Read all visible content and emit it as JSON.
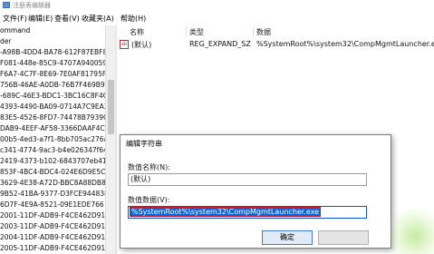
{
  "window": {
    "title": "注册表编辑器"
  },
  "menubar": [
    "文件(F)",
    "编辑(E)",
    "查看(V)",
    "收藏夹(A)",
    "帮助(H)"
  ],
  "tree": [
    {
      "label": "ommand",
      "selected": true
    },
    {
      "label": "der",
      "selected": false
    },
    {
      "label": "-A98B-4DD4-BA78-612F87EBF8",
      "selected": false
    },
    {
      "label": "F081-448e-85C9-4707A9400593",
      "selected": false
    },
    {
      "label": "F6A7-4C7F-8E69-7E0AF81795FB",
      "selected": false
    },
    {
      "label": "756B-46AE-A0DB-76B7F469B92",
      "selected": false
    },
    {
      "label": "-689C-46E3-BDC1-3BC16C8F4C5",
      "selected": false
    },
    {
      "label": "4393-4490-BA09-0714A7C9EA3",
      "selected": false
    },
    {
      "label": "83E5-4526-8FD7-74478B7939CD",
      "selected": false
    },
    {
      "label": "DAB9-4EEF-AF58-3366DAAF4C4",
      "selected": false
    },
    {
      "label": "00b5-4ed3-a7f1-8bb705ac276a",
      "selected": false
    },
    {
      "label": "c341-4774-9ac3-b4e026347f64",
      "selected": false
    },
    {
      "label": "2419-4373-b102-6843707eb41",
      "selected": false
    },
    {
      "label": "853F-4BC4-BDC4-024E6D9E5C5",
      "selected": false
    },
    {
      "label": "3629-4E38-A72D-BBC8A88DB81",
      "selected": false
    },
    {
      "label": "9B52-41BA-9377-D3FCE9448381",
      "selected": false
    },
    {
      "label": "6D7F-4E9A-8521-09E1EDE766",
      "selected": false
    },
    {
      "label": "2001-11DF-ADB9-F4CE462D913",
      "selected": false
    },
    {
      "label": "2003-11DF-ADB9-F4CE462D913",
      "selected": false
    },
    {
      "label": "2004-11DF-ADB9-F4CE462D913",
      "selected": false
    },
    {
      "label": "2005-11DF-ADB9-F4CE462D913",
      "selected": false
    }
  ],
  "columns": {
    "name": "名称",
    "type": "类型",
    "data": "数据"
  },
  "value_row": {
    "icon": "string-value-icon",
    "icon_text": "ab",
    "name": "(默认)",
    "type": "REG_EXPAND_SZ",
    "data": "%SystemRoot%\\system32\\CompMgmtLauncher.exe"
  },
  "dialog": {
    "title": "编辑字符串",
    "name_label": "数值名称(N):",
    "name_value": "(默认)",
    "data_label": "数值数据(V):",
    "data_value": "%SystemRoot%\\system32\\CompMgmtLauncher.exe",
    "ok_label": "确定",
    "cancel_label": ""
  },
  "colors": {
    "selection": "#0a64d6",
    "highlight_outline": "#d2142a"
  }
}
